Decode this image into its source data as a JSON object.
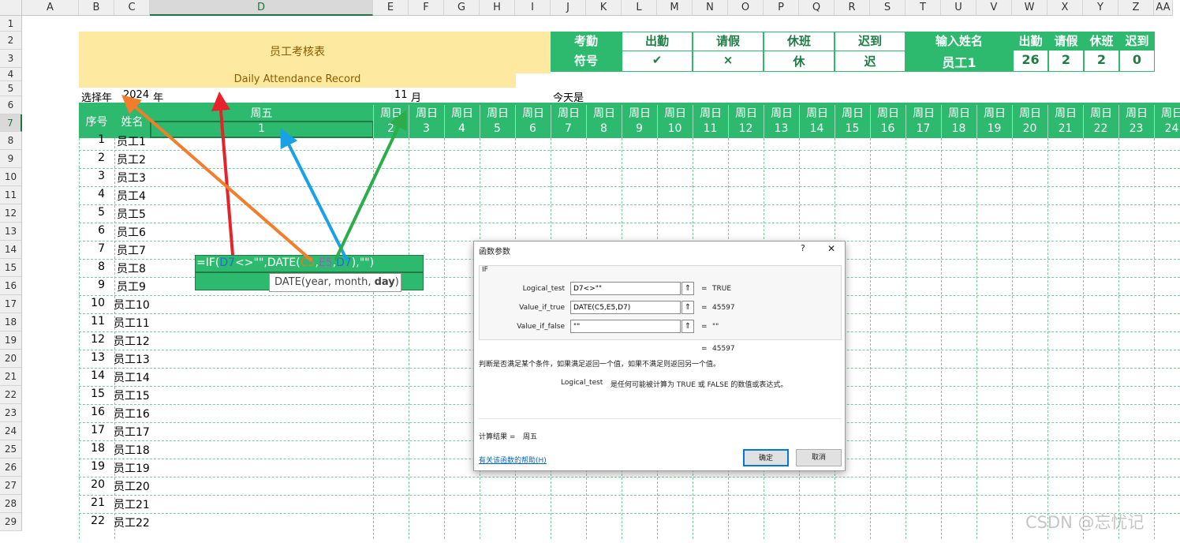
{
  "columns": [
    "A",
    "B",
    "C",
    "D",
    "E",
    "F",
    "G",
    "H",
    "I",
    "J",
    "K",
    "L",
    "M",
    "N",
    "O",
    "P",
    "Q",
    "R",
    "S",
    "T",
    "U",
    "V",
    "W",
    "X",
    "Y",
    "Z",
    "AA"
  ],
  "rows": [
    "1",
    "2",
    "3",
    "4",
    "5",
    "6",
    "7",
    "8",
    "9",
    "10",
    "11",
    "12",
    "13",
    "14",
    "15",
    "16",
    "17",
    "18",
    "19",
    "20",
    "21",
    "22",
    "23",
    "24",
    "25",
    "26",
    "27",
    "28",
    "29"
  ],
  "title": {
    "cn": "员工考核表",
    "en": "Daily Attendance Record"
  },
  "legend": {
    "label1": "考勤",
    "label2": "符号",
    "items": [
      {
        "name": "出勤",
        "sym": "✔"
      },
      {
        "name": "请假",
        "sym": "×"
      },
      {
        "name": "休班",
        "sym": "休"
      },
      {
        "name": "迟到",
        "sym": "迟"
      }
    ]
  },
  "lookup": {
    "label": "输入姓名",
    "value": "员工1",
    "stats": [
      {
        "name": "出勤",
        "val": "26"
      },
      {
        "name": "请假",
        "val": "2"
      },
      {
        "name": "休班",
        "val": "2"
      },
      {
        "name": "迟到",
        "val": "0"
      }
    ]
  },
  "row5": {
    "year_label": "选择年",
    "year": "2024",
    "year_unit": "年",
    "month": "11",
    "month_unit": "月",
    "today": "今天是"
  },
  "table_hdr": {
    "seq": "序号",
    "name": "姓名",
    "d_day": "周五",
    "d_date": "1",
    "weekdays": [
      "周日",
      "周日",
      "周日",
      "周日",
      "周日",
      "周日",
      "周日",
      "周日",
      "周日",
      "周日",
      "周日",
      "周日",
      "周日",
      "周日",
      "周日",
      "周日",
      "周日",
      "周日",
      "周日",
      "周日",
      "周日",
      "周日",
      "周日",
      "周日"
    ],
    "dates": [
      "2",
      "3",
      "4",
      "5",
      "6",
      "7",
      "8",
      "9",
      "10",
      "11",
      "12",
      "13",
      "14",
      "15",
      "16",
      "17",
      "18",
      "19",
      "20",
      "21",
      "22",
      "23",
      "24"
    ]
  },
  "employees": [
    [
      "1",
      "员工1"
    ],
    [
      "2",
      "员工2"
    ],
    [
      "3",
      "员工3"
    ],
    [
      "4",
      "员工4"
    ],
    [
      "5",
      "员工5"
    ],
    [
      "6",
      "员工6"
    ],
    [
      "7",
      "员工7"
    ],
    [
      "8",
      "员工8"
    ],
    [
      "9",
      "员工9"
    ],
    [
      "10",
      "员工10"
    ],
    [
      "11",
      "员工11"
    ],
    [
      "12",
      "员工12"
    ],
    [
      "13",
      "员工13"
    ],
    [
      "14",
      "员工14"
    ],
    [
      "15",
      "员工15"
    ],
    [
      "16",
      "员工16"
    ],
    [
      "17",
      "员工17"
    ],
    [
      "18",
      "员工18"
    ],
    [
      "19",
      "员工19"
    ],
    [
      "20",
      "员工20"
    ],
    [
      "21",
      "员工21"
    ],
    [
      "22",
      "员工22"
    ]
  ],
  "formula": {
    "pre": "=IF(",
    "r1": "D7",
    "mid1": "<>\"\",DATE(",
    "r2": "C5",
    ",": ",",
    "r3": "E5",
    "c2": ",",
    "r4": "D7",
    "post": "),\"\")"
  },
  "tooltip": {
    "text": "DATE(year, month, ",
    "bold": "day",
    ")": ")"
  },
  "dialog": {
    "title": "函数参数",
    "help": "?",
    "close": "✕",
    "fn": "IF",
    "args": [
      {
        "label": "Logical_test",
        "value": "D7<>\"\"",
        "result": "TRUE"
      },
      {
        "label": "Value_if_true",
        "value": "DATE(C5,E5,D7)",
        "result": "45597"
      },
      {
        "label": "Value_if_false",
        "value": "\"\"",
        "result": "\"\""
      }
    ],
    "eq": "=",
    "total": "45597",
    "desc": "判断是否满足某个条件，如果满足返回一个值，如果不满足则返回另一个值。",
    "arg_desc_label": "Logical_test",
    "arg_desc": "是任何可能被计算为 TRUE 或 FALSE 的数值或表达式。",
    "calc_label": "计算结果 =",
    "calc_value": "周五",
    "help_link": "有关该函数的帮助(H)",
    "ok": "确定",
    "cancel": "取消"
  },
  "watermark": "CSDN @忘忧记",
  "colors": {
    "green": "#2dba6e",
    "yellow": "#fdeaa0",
    "arrow_red": "#e8222b",
    "arrow_orange": "#f47d2b",
    "arrow_blue": "#18a1e6",
    "arrow_green": "#2bae4a"
  }
}
